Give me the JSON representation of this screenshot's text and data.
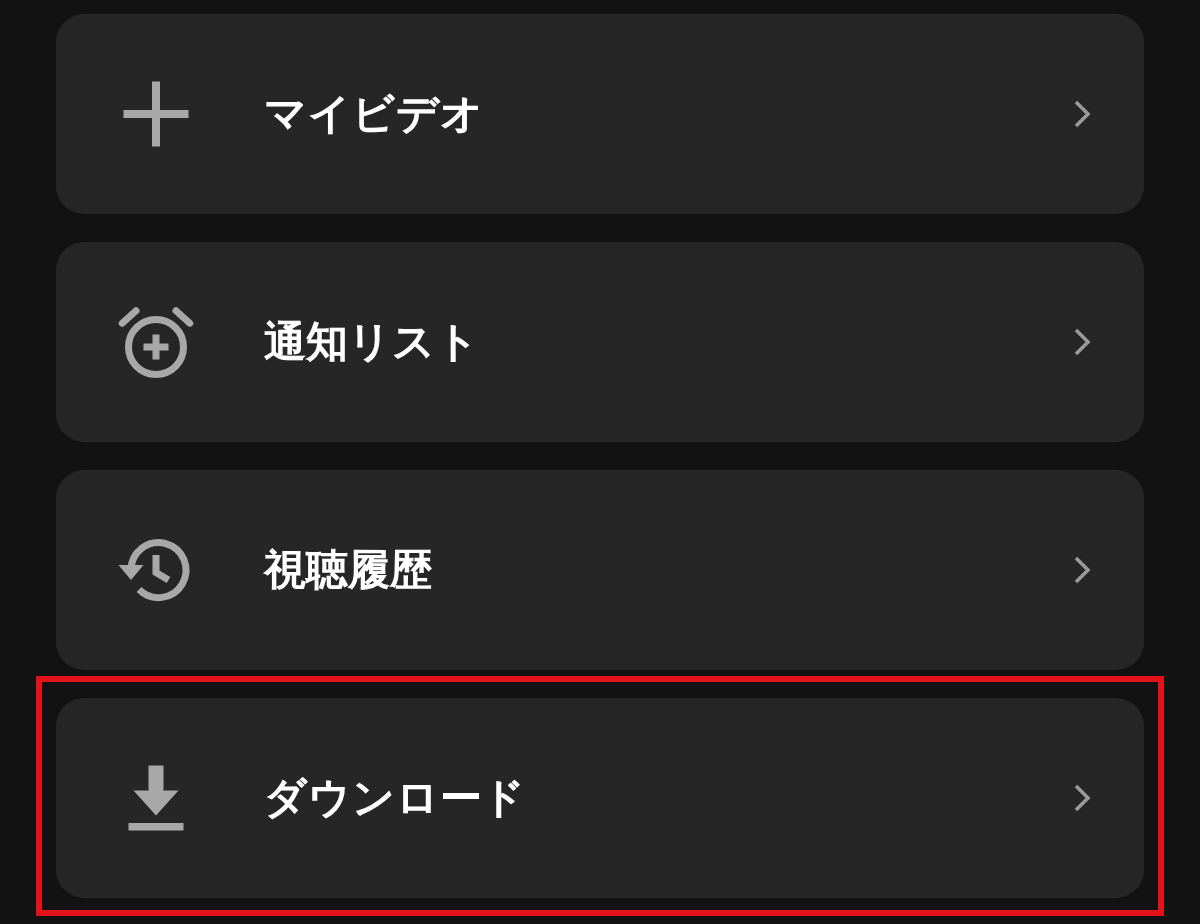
{
  "menu_items": [
    {
      "kind": "plus",
      "label": "マイビデオ",
      "highlighted": false
    },
    {
      "kind": "alarm",
      "label": "通知リスト",
      "highlighted": false
    },
    {
      "kind": "history",
      "label": "視聴履歴",
      "highlighted": false
    },
    {
      "kind": "download",
      "label": "ダウンロード",
      "highlighted": true
    }
  ]
}
